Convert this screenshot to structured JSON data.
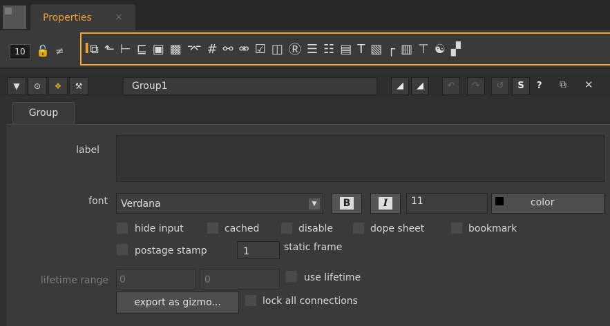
{
  "tab": {
    "title": "Properties",
    "close_icon": "×"
  },
  "toolbar": {
    "max_panels": "10"
  },
  "node": {
    "name": "Group1",
    "help": "?",
    "s_label": "S"
  },
  "tabs": {
    "active": "Group"
  },
  "knobs": {
    "label": {
      "label": "label",
      "value": ""
    },
    "font": {
      "label": "font",
      "value": "Verdana",
      "bold": "B",
      "italic": "I",
      "size": "11",
      "color_label": "color"
    },
    "checkboxes": {
      "hide_input": "hide input",
      "cached": "cached",
      "disable": "disable",
      "dope_sheet": "dope sheet",
      "bookmark": "bookmark",
      "postage_stamp": "postage stamp",
      "use_lifetime": "use lifetime",
      "lock_all": "lock all connections"
    },
    "postage_frame": {
      "value": "1",
      "label": "static frame"
    },
    "lifetime": {
      "label": "lifetime range",
      "start": "0",
      "end": "0"
    },
    "export_button": "export as gizmo..."
  },
  "colors": {
    "accent": "#f0a030",
    "highlight_box": "#f0a830",
    "panel_bg": "#3a3a3a"
  }
}
